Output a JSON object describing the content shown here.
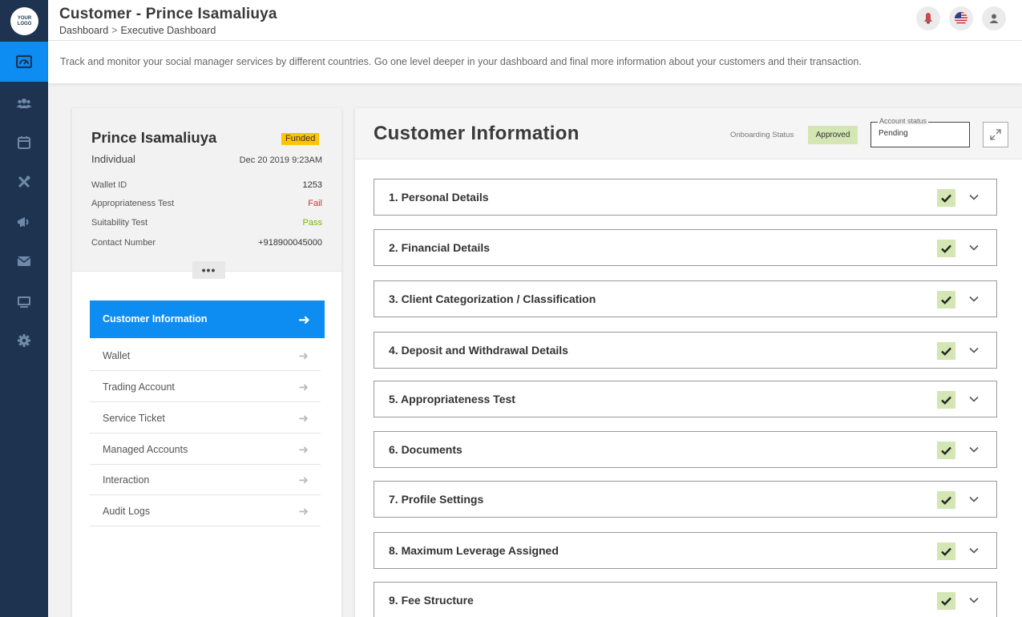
{
  "logo": {
    "line1": "YOUR",
    "line2": "LOGO"
  },
  "header": {
    "title": "Customer - Prince Isamaliuya",
    "breadcrumb": [
      "Dashboard",
      "Executive Dashboard"
    ],
    "breadcrumb_separator": ">",
    "icons": [
      "notification-icon",
      "us-flag-icon",
      "user-icon"
    ]
  },
  "description": "Track and monitor your social manager services by different countries. Go one level deeper in your dashboard and final more information about your customers and their transaction.",
  "sidebar": {
    "items": [
      {
        "icon": "dashboard-icon",
        "active": true
      },
      {
        "icon": "users-icon",
        "active": false
      },
      {
        "icon": "calendar-icon",
        "active": false
      },
      {
        "icon": "tools-icon",
        "active": false
      },
      {
        "icon": "megaphone-icon",
        "active": false
      },
      {
        "icon": "mail-icon",
        "active": false
      },
      {
        "icon": "monitor-icon",
        "active": false
      },
      {
        "icon": "settings-icon",
        "active": false
      }
    ]
  },
  "customer": {
    "name": "Prince Isamaliuya",
    "badge": "Funded",
    "type": "Individual",
    "date": "Dec 20 2019 9:23AM",
    "fields": [
      {
        "label": "Wallet ID",
        "value": "1253",
        "status": ""
      },
      {
        "label": "Appropriateness Test",
        "value": "Fail",
        "status": "fail"
      },
      {
        "label": "Suitability Test",
        "value": "Pass",
        "status": "pass"
      },
      {
        "label": "Contact Number",
        "value": "+918900045000",
        "status": ""
      }
    ],
    "more": "•••"
  },
  "menu": {
    "active": "Customer Information",
    "items": [
      "Wallet",
      "Trading Account",
      "Service Ticket",
      "Managed Accounts",
      "Interaction",
      "Audit Logs"
    ]
  },
  "main": {
    "title": "Customer Information",
    "onboarding_label": "Onboarding Status",
    "onboarding_value": "Approved",
    "account_status_label": "Account status",
    "account_status_value": "Pending",
    "sections": [
      "1. Personal Details",
      "2. Financial Details",
      "3. Client Categorization / Classification",
      "4. Deposit and Withdrawal Details",
      "5. Appropriateness Test",
      "6. Documents",
      "7. Profile Settings",
      "8. Maximum Leverage Assigned",
      "9. Fee Structure"
    ]
  },
  "colors": {
    "sidebar": "#1e3350",
    "accent": "#0d8cf2",
    "funded": "#ffc400",
    "approved": "#d3e6b3",
    "fail": "#c0392b",
    "pass": "#7ab800"
  }
}
